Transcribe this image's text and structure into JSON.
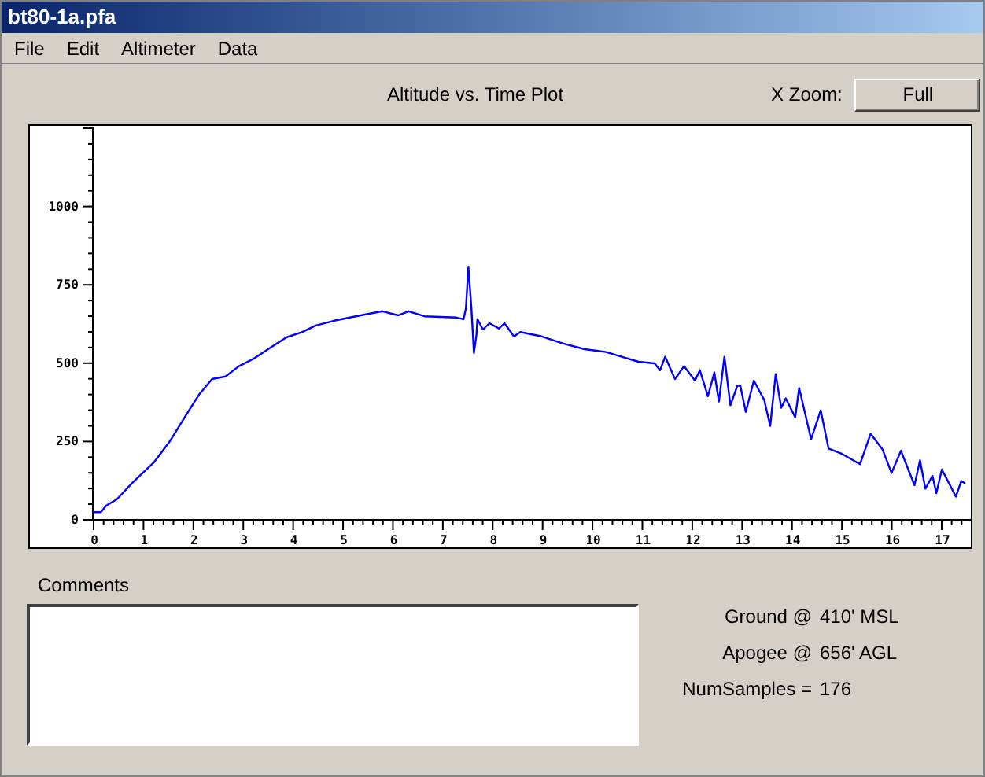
{
  "window": {
    "title": "bt80-1a.pfa"
  },
  "menu": [
    "File",
    "Edit",
    "Altimeter",
    "Data"
  ],
  "plot": {
    "title": "Altitude vs. Time Plot",
    "zoom_label": "X Zoom:",
    "zoom_button": "Full",
    "chart_data": {
      "type": "line",
      "xlim": [
        0,
        17.6
      ],
      "ylim": [
        0,
        1250
      ],
      "xticks": [
        0,
        1,
        2,
        3,
        4,
        5,
        6,
        7,
        8,
        9,
        10,
        11,
        12,
        13,
        14,
        15,
        16,
        17
      ],
      "yticks": [
        0,
        250,
        500,
        750,
        1000
      ],
      "x": [
        0,
        0.16,
        0.27,
        0.48,
        0.8,
        1.22,
        1.54,
        1.86,
        2.13,
        2.39,
        2.66,
        2.93,
        3.24,
        3.56,
        3.88,
        4.2,
        4.47,
        4.84,
        5.27,
        5.8,
        6.12,
        6.33,
        6.65,
        7.29,
        7.43,
        7.48,
        7.53,
        7.59,
        7.64,
        7.69,
        7.71,
        7.82,
        7.95,
        8.14,
        8.25,
        8.44,
        8.57,
        9.0,
        9.43,
        9.86,
        10.29,
        10.6,
        10.94,
        11.26,
        11.37,
        11.47,
        11.67,
        11.85,
        12.07,
        12.17,
        12.33,
        12.46,
        12.55,
        12.66,
        12.78,
        12.92,
        12.98,
        13.09,
        13.25,
        13.46,
        13.58,
        13.69,
        13.8,
        13.89,
        14.08,
        14.16,
        14.4,
        14.59,
        14.75,
        15.02,
        15.38,
        15.59,
        15.83,
        16.01,
        16.2,
        16.47,
        16.58,
        16.69,
        16.83,
        16.91,
        17.02,
        17.3,
        17.41,
        17.49
      ],
      "series": [
        {
          "color": "#0000ff",
          "values": [
            22,
            22,
            43,
            63,
            117,
            180,
            247,
            330,
            397,
            447,
            455,
            488,
            513,
            547,
            580,
            597,
            618,
            633,
            647,
            663,
            650,
            663,
            647,
            643,
            638,
            672,
            805,
            672,
            530,
            588,
            638,
            605,
            625,
            608,
            625,
            583,
            597,
            583,
            560,
            542,
            533,
            518,
            502,
            497,
            475,
            518,
            447,
            488,
            442,
            475,
            392,
            468,
            375,
            518,
            363,
            425,
            425,
            342,
            442,
            380,
            297,
            463,
            355,
            385,
            325,
            418,
            255,
            347,
            225,
            208,
            175,
            272,
            222,
            147,
            218,
            108,
            188,
            97,
            138,
            83,
            158,
            72,
            122,
            113
          ]
        }
      ]
    }
  },
  "comments": {
    "label": "Comments"
  },
  "stats": [
    {
      "label": "Ground @",
      "value": "410' MSL"
    },
    {
      "label": "Apogee @",
      "value": "656' AGL"
    },
    {
      "label": "NumSamples =",
      "value": "176"
    }
  ]
}
